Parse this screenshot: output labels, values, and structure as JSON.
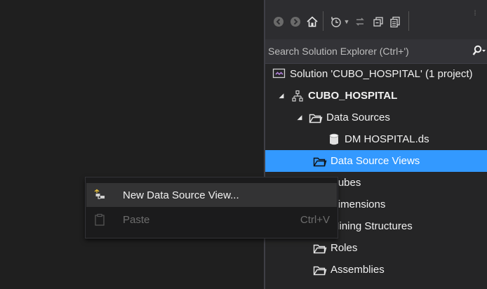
{
  "solution_explorer": {
    "search_placeholder": "Search Solution Explorer (Ctrl+')",
    "toolbar": [
      {
        "icon": "back-icon"
      },
      {
        "icon": "forward-icon"
      },
      {
        "icon": "home-icon"
      },
      {
        "icon": "history-icon"
      },
      {
        "icon": "sync-icon"
      },
      {
        "icon": "collapse-all-icon"
      },
      {
        "icon": "show-all-files-icon"
      }
    ],
    "tree": [
      {
        "label": "Solution 'CUBO_HOSPITAL' (1 project)",
        "icon": "solution-icon"
      },
      {
        "label": "CUBO_HOSPITAL",
        "icon": "project-icon"
      },
      {
        "label": "Data Sources",
        "icon": "folder-icon"
      },
      {
        "label": "DM HOSPITAL.ds",
        "icon": "database-icon"
      },
      {
        "label": "Data Source Views",
        "icon": "folder-icon"
      },
      {
        "label": "Cubes",
        "icon": "folder-icon"
      },
      {
        "label": "Dimensions",
        "icon": "folder-icon"
      },
      {
        "label": "Mining Structures",
        "icon": "folder-icon"
      },
      {
        "label": "Roles",
        "icon": "folder-icon"
      },
      {
        "label": "Assemblies",
        "icon": "folder-icon"
      }
    ]
  },
  "context_menu": {
    "items": [
      {
        "label": "New Data Source View...",
        "icon": "new-dsv-icon",
        "shortcut": "",
        "enabled": true
      },
      {
        "label": "Paste",
        "icon": "paste-icon",
        "shortcut": "Ctrl+V",
        "enabled": false
      }
    ]
  },
  "colors": {
    "selection": "#3399ff",
    "background": "#1f1f1f",
    "menu_background": "#1b1b1c"
  }
}
